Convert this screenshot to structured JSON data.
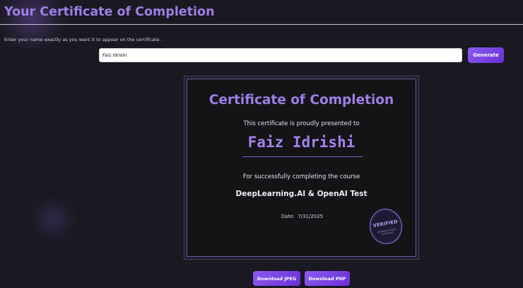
{
  "page": {
    "title": "Your Certificate of Completion",
    "instructions": "Enter your name exactly as you want it to appear on the certificate."
  },
  "form": {
    "name_value": "Faiz Idrishi",
    "generate_label": "Generate"
  },
  "certificate": {
    "heading": "Certificate of Completion",
    "presented_text": "This certificate is proudly presented to",
    "recipient_name": "Faiz Idrishi",
    "course_intro": "For successfully completing the course",
    "course_name": "DeepLearning.AI & OpenAI Test",
    "date_label": "Date:",
    "date_value": "7/31/2025",
    "seal": {
      "label": "VERIFIED",
      "subtext": "deeplearning.ai certificate"
    }
  },
  "actions": {
    "download_jpeg_label": "Download JPEG",
    "download_pdf_label": "Download PDF"
  },
  "colors": {
    "background": "#1a1821",
    "accent": "#9d7fe6",
    "button_gradient_start": "#8c5cf0",
    "button_gradient_end": "#6a2fd6"
  }
}
